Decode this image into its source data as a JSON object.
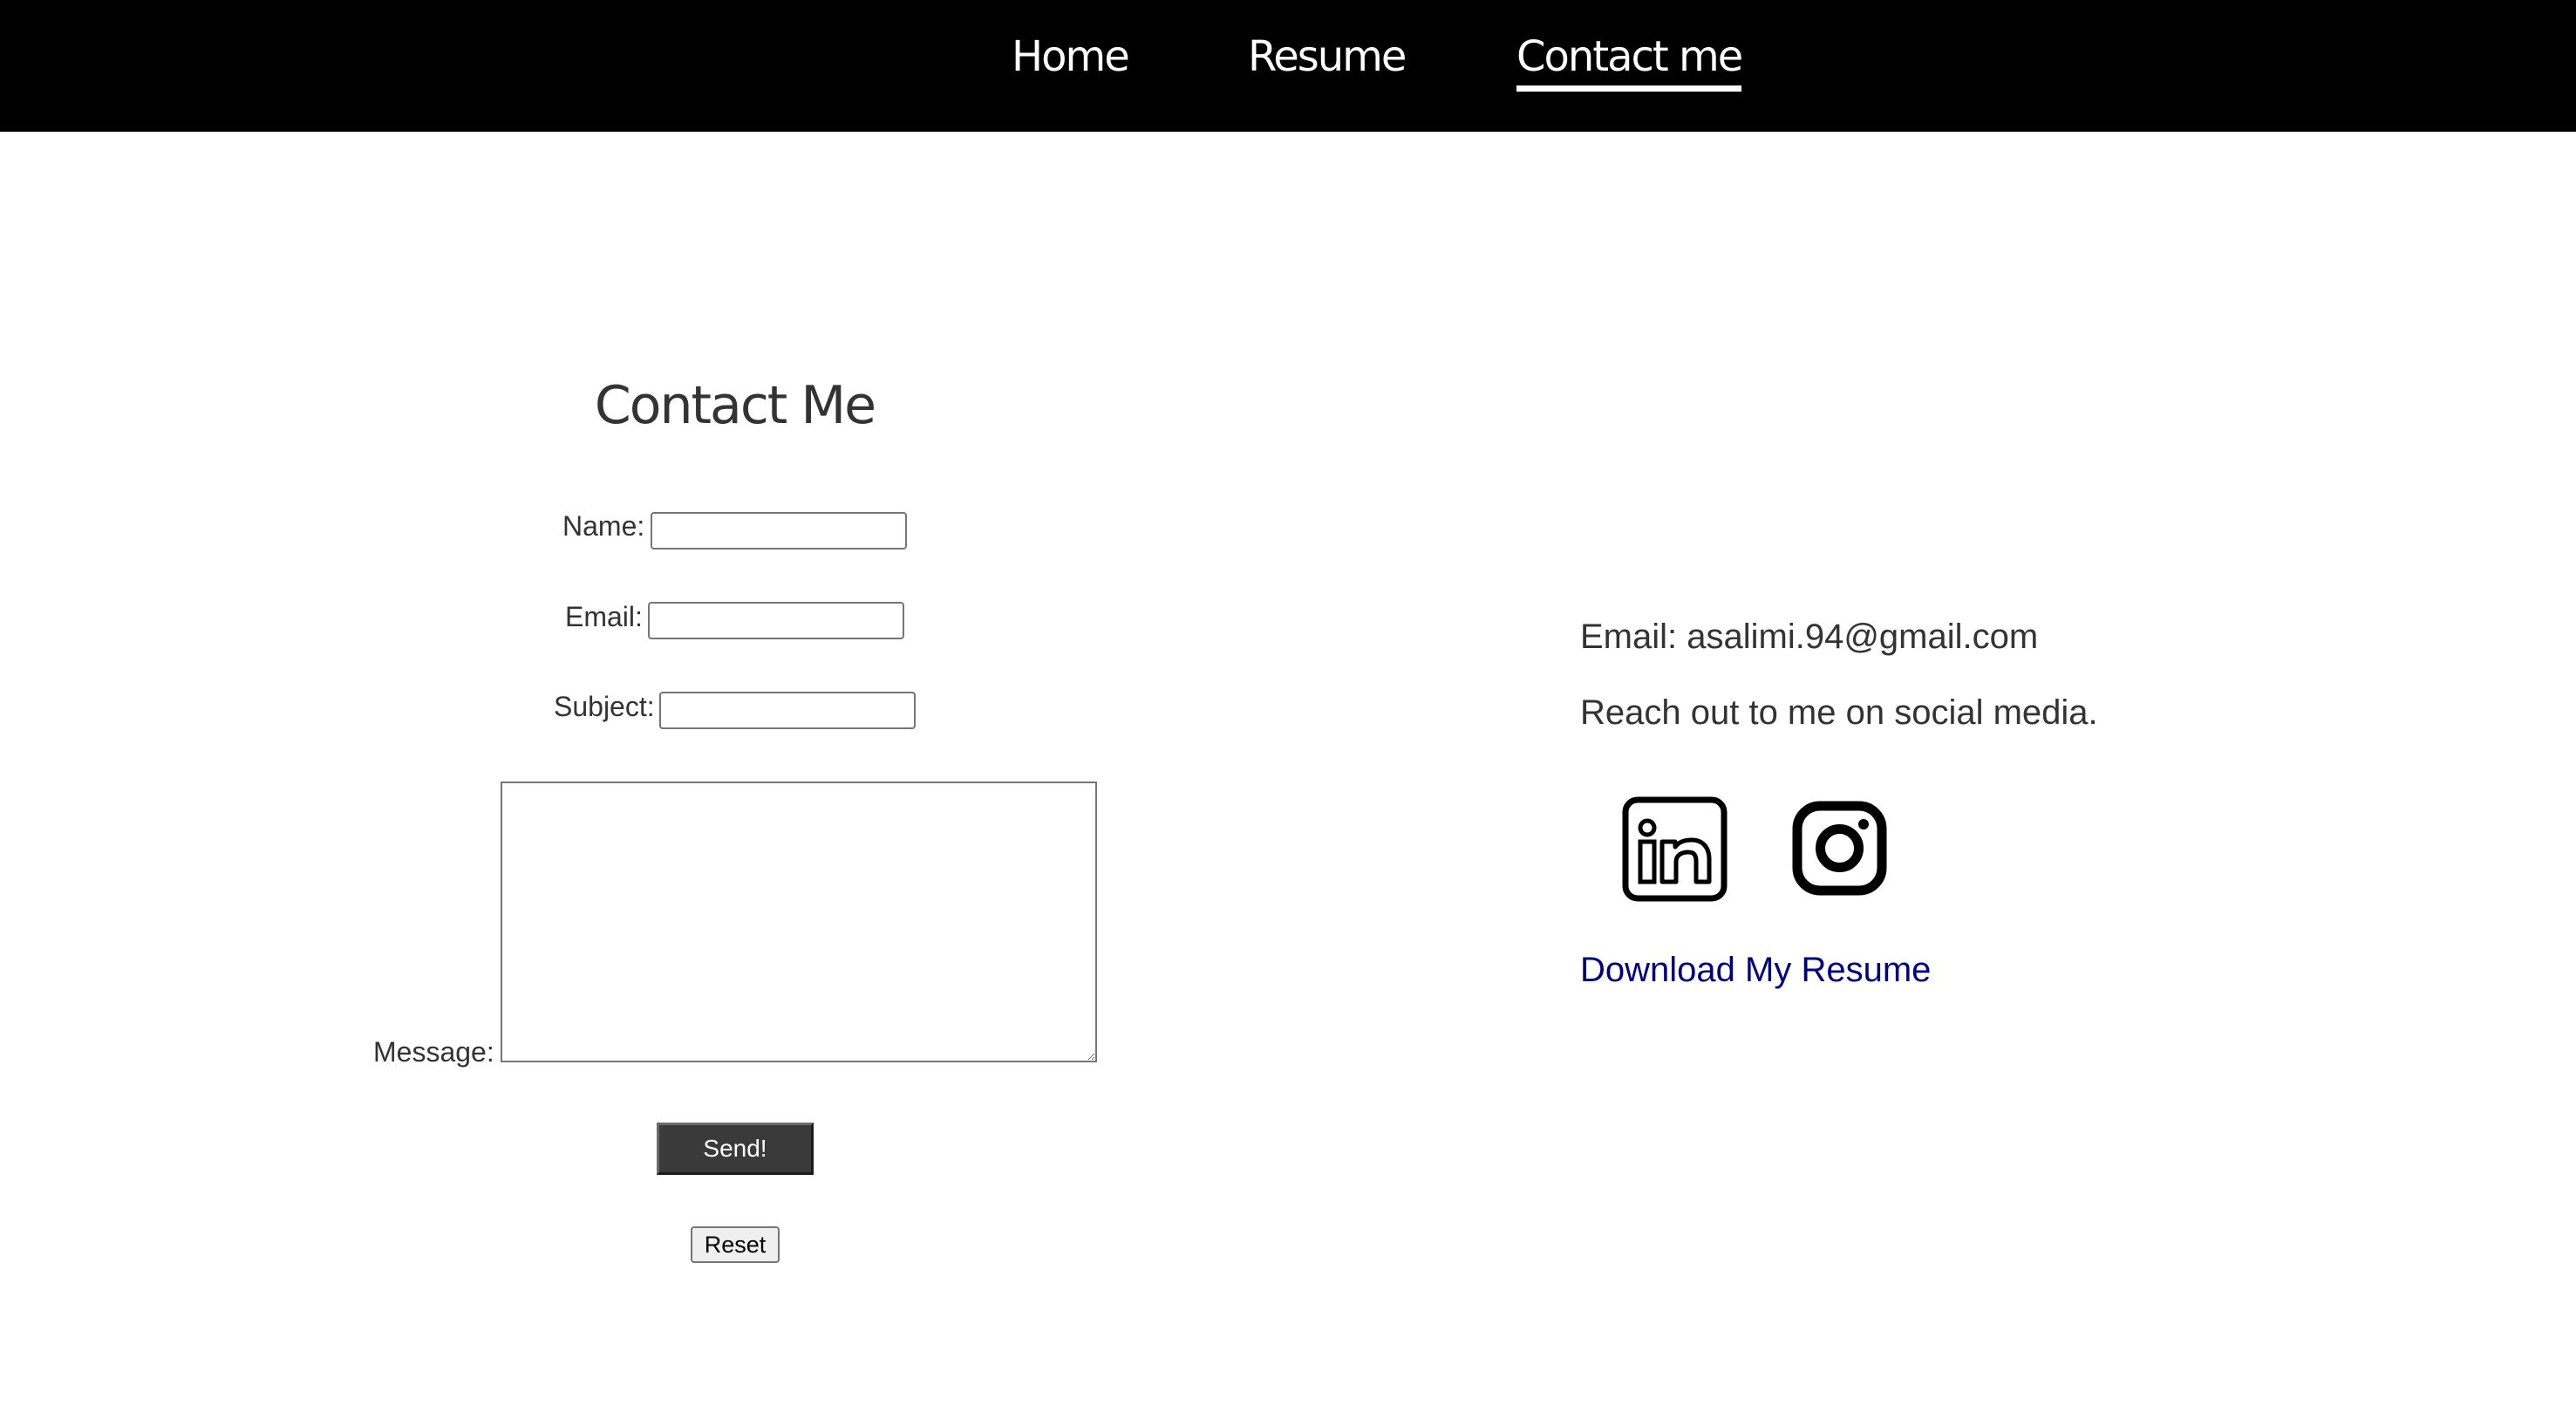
{
  "nav": {
    "home": "Home",
    "resume": "Resume",
    "contact": "Contact me",
    "active": "contact"
  },
  "form": {
    "heading": "Contact Me",
    "name_label": "Name:",
    "name_value": "",
    "email_label": "Email:",
    "email_value": "",
    "subject_label": "Subject:",
    "subject_value": "",
    "message_label": "Message:",
    "message_value": "",
    "send_label": "Send!",
    "reset_label": "Reset"
  },
  "info": {
    "email_line": "Email: asalimi.94@gmail.com",
    "social_line": "Reach out to me on social media.",
    "social_icons": [
      "linkedin-icon",
      "instagram-icon"
    ],
    "resume_link": "Download My Resume"
  },
  "colors": {
    "navbar_bg": "#000000",
    "nav_text": "#ffffff",
    "body_text": "#333333",
    "link": "#000080",
    "send_button_bg": "#3a3a3a"
  }
}
